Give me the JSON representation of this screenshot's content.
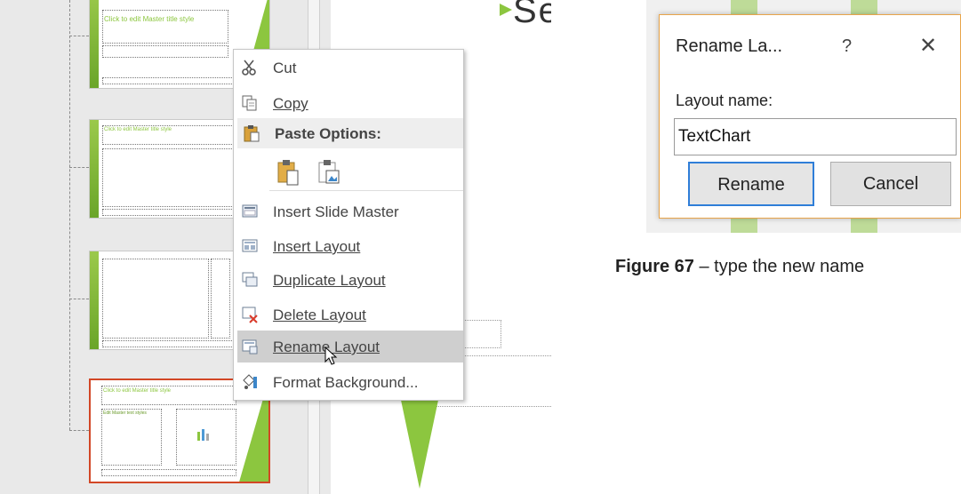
{
  "thumbnails": {
    "master_title_placeholder": "Click to edit Master title style",
    "master_text_placeholder": "Edit Master text styles"
  },
  "slide_preview": {
    "partial_title_text": "Se"
  },
  "context_menu": {
    "items": [
      {
        "label": "Cut",
        "icon": "scissors-icon"
      },
      {
        "label": "Copy",
        "icon": "copy-icon"
      },
      {
        "label": "Paste Options:",
        "icon": "paste-icon"
      },
      {
        "label": "Insert Slide Master",
        "icon": "insert-slide-master-icon"
      },
      {
        "label": "Insert Layout",
        "icon": "insert-layout-icon"
      },
      {
        "label": "Duplicate Layout",
        "icon": "duplicate-layout-icon"
      },
      {
        "label": "Delete Layout",
        "icon": "delete-layout-icon"
      },
      {
        "label": "Rename Layout",
        "icon": "rename-layout-icon"
      },
      {
        "label": "Format Background...",
        "icon": "format-background-icon"
      }
    ],
    "highlighted_item": "Rename Layout"
  },
  "rename_dialog": {
    "title": "Rename La...",
    "help_glyph": "?",
    "close_glyph": "✕",
    "field_label": "Layout name:",
    "field_value": "TextChart",
    "rename_button": "Rename",
    "cancel_button": "Cancel"
  },
  "caption": {
    "figure": "Figure 67",
    "text": "– type the new name"
  },
  "colors": {
    "accent_green": "#8cc63f",
    "selection_border": "#d24726",
    "dialog_primary_border": "#2f7ed8",
    "dialog_frame": "#e8a44a"
  }
}
